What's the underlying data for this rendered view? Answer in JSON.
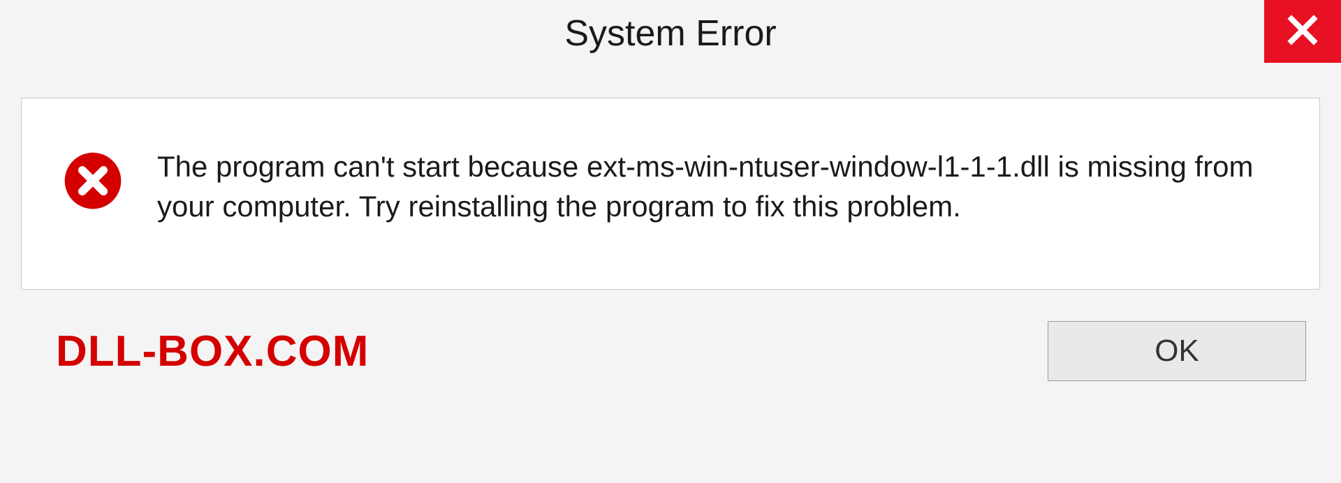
{
  "titlebar": {
    "title": "System Error"
  },
  "message": {
    "text": "The program can't start because ext-ms-win-ntuser-window-l1-1-1.dll is missing from your computer. Try reinstalling the program to fix this problem."
  },
  "footer": {
    "watermark": "DLL-BOX.COM",
    "ok_label": "OK"
  },
  "colors": {
    "close_bg": "#e81123",
    "error_icon": "#d40000",
    "watermark": "#d40000"
  }
}
